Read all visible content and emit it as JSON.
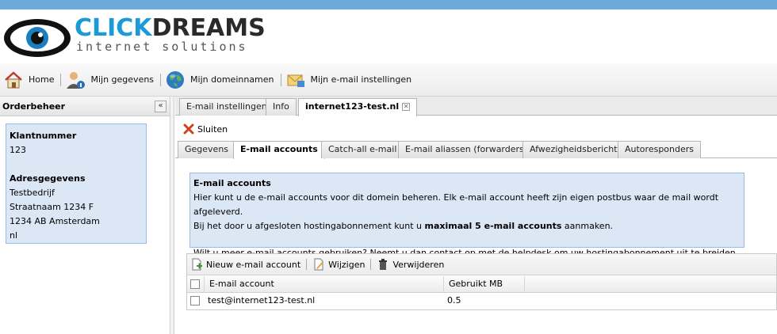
{
  "brand": {
    "part1": "CLICK",
    "part2": "DREAMS",
    "tagline": "internet solutions",
    "accent": "#1a9ad6"
  },
  "nav": [
    {
      "label": "Home",
      "icon": "home-icon"
    },
    {
      "label": "Mijn gegevens",
      "icon": "user-info-icon"
    },
    {
      "label": "Mijn domeinnamen",
      "icon": "globe-icon"
    },
    {
      "label": "Mijn e-mail instellingen",
      "icon": "email-settings-icon"
    }
  ],
  "left": {
    "title": "Orderbeheer",
    "collapse": "«",
    "klant_label": "Klantnummer",
    "klant_value": "123",
    "adres_label": "Adresgegevens",
    "adres_lines": [
      "Testbedrijf",
      "Straatnaam 1234 F",
      "1234 AB Amsterdam",
      "nl"
    ]
  },
  "tabs": [
    {
      "label": "E-mail instellingen"
    },
    {
      "label": "Info"
    },
    {
      "label": "internet123-test.nl",
      "closable": true
    }
  ],
  "toolbar": {
    "close_label": "Sluiten"
  },
  "subtabs": [
    {
      "label": "Gegevens"
    },
    {
      "label": "E-mail accounts"
    },
    {
      "label": "Catch-all e-mail"
    },
    {
      "label": "E-mail aliassen (forwarders)"
    },
    {
      "label": "Afwezigheidsbericht"
    },
    {
      "label": "Autoresponders"
    }
  ],
  "desc": {
    "title": "E-mail accounts",
    "line1": "Hier kunt u de e-mail accounts voor dit domein beheren. Elk e-mail account heeft zijn eigen postbus waar de mail wordt afgeleverd.",
    "line2_pre": "Bij het door u afgesloten hostingabonnement kunt u ",
    "line2_bold": "maximaal 5 e-mail accounts",
    "line2_post": " aanmaken.",
    "line3": "Wilt u meer e-mail accounts gebruiken? Neemt u dan contact op met de helpdesk om uw hostingabonnement uit te breiden."
  },
  "grid": {
    "new_label": "Nieuw e-mail account",
    "edit_label": "Wijzigen",
    "delete_label": "Verwijderen",
    "col_account": "E-mail account",
    "col_used": "Gebruikt MB",
    "rows": [
      {
        "account": "test@internet123-test.nl",
        "used": "0.5"
      }
    ]
  }
}
